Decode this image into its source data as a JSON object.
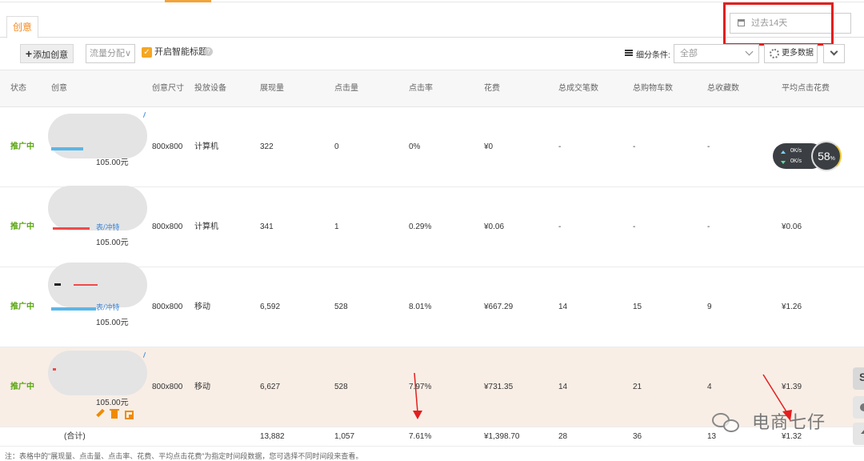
{
  "tabs": [
    {
      "label": "创意"
    }
  ],
  "date_range": {
    "value": "过去14天",
    "icon": "calendar-icon"
  },
  "toolbar": {
    "add_label": "添加创意",
    "flow_label": "流量分配",
    "smart_title_label": "开启智能标题",
    "smart_title_checked": true,
    "segment_label": "细分条件:",
    "segment_value": "全部",
    "more_data_label": "更多数据"
  },
  "table": {
    "columns": [
      "状态",
      "创意",
      "创意尺寸",
      "投放设备",
      "展现量",
      "点击量",
      "点击率",
      "花费",
      "总成交笔数",
      "总购物车数",
      "总收藏数",
      "平均点击花费"
    ],
    "rows": [
      {
        "status": "推广中",
        "thumb_tag": "",
        "price": "105.00元",
        "size": "800x800",
        "device": "计算机",
        "impressions": "322",
        "clicks": "0",
        "ctr": "0%",
        "cost": "¥0",
        "orders": "-",
        "carts": "-",
        "favs": "-",
        "cpc": ""
      },
      {
        "status": "推广中",
        "thumb_tag": "表/冲特",
        "price": "105.00元",
        "size": "800x800",
        "device": "计算机",
        "impressions": "341",
        "clicks": "1",
        "ctr": "0.29%",
        "cost": "¥0.06",
        "orders": "-",
        "carts": "-",
        "favs": "-",
        "cpc": "¥0.06"
      },
      {
        "status": "推广中",
        "thumb_tag": "表/冲特",
        "price": "105.00元",
        "size": "800x800",
        "device": "移动",
        "impressions": "6,592",
        "clicks": "528",
        "ctr": "8.01%",
        "cost": "¥667.29",
        "orders": "14",
        "carts": "15",
        "favs": "9",
        "cpc": "¥1.26"
      },
      {
        "status": "推广中",
        "thumb_tag": "",
        "price": "105.00元",
        "size": "800x800",
        "device": "移动",
        "impressions": "6,627",
        "clicks": "528",
        "ctr": "7.97%",
        "cost": "¥731.35",
        "orders": "14",
        "carts": "21",
        "favs": "4",
        "cpc": "¥1.39"
      }
    ],
    "totals": {
      "label": "(合计)",
      "impressions": "13,882",
      "clicks": "1,057",
      "ctr": "7.61%",
      "cost": "¥1,398.70",
      "orders": "28",
      "carts": "36",
      "favs": "13",
      "cpc": "¥1.32"
    }
  },
  "row_actions": [
    "edit-icon",
    "delete-icon",
    "copy-icon"
  ],
  "footnote": "注：表格中的\"展现量、点击量、点击率、花费、平均点击花费\"为指定时间段数据，您可选择不同时间段来查看。",
  "speed_widget": {
    "up": "0K/s",
    "down": "0K/s",
    "percent": "58",
    "percent_unit": "%"
  },
  "watermark": "电商七仔",
  "side_buttons": {
    "s_label": "S"
  },
  "colors": {
    "accent": "#f5891f",
    "status_green": "#59a60f",
    "highlight_row": "#f8eee6",
    "annotation_red": "#e41e1e"
  }
}
